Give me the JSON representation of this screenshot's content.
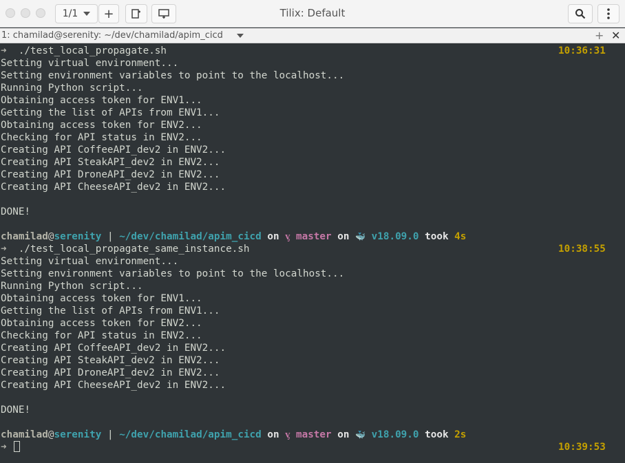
{
  "window": {
    "title": "Tilix: Default",
    "session_counter": "1/1"
  },
  "tab": {
    "title": "1: chamilad@serenity: ~/dev/chamilad/apim_cicd",
    "add": "+",
    "close": "✕"
  },
  "prompt_arrow": "➜",
  "blocks": [
    {
      "command": "./test_local_propagate.sh",
      "time": "10:36:31",
      "output": [
        "Setting virtual environment...",
        "Setting environment variables to point to the localhost...",
        "Running Python script...",
        "Obtaining access token for ENV1...",
        "Getting the list of APIs from ENV1...",
        "Obtaining access token for ENV2...",
        "Checking for API status in ENV2...",
        "Creating API CoffeeAPI_dev2 in ENV2...",
        "Creating API SteakAPI_dev2 in ENV2...",
        "Creating API DroneAPI_dev2 in ENV2...",
        "Creating API CheeseAPI_dev2 in ENV2...",
        "",
        "DONE!"
      ],
      "status": {
        "user": "chamilad",
        "at": "@",
        "host": "serenity",
        "sep": "|",
        "path": "~/dev/chamilad/apim_cicd",
        "on1": "on",
        "git_icon": "ᶌ",
        "branch": "master",
        "on2": "on",
        "docker_icon": "🐳",
        "version": "v18.09.0",
        "took": "took",
        "duration": "4s"
      }
    },
    {
      "command": "./test_local_propagate_same_instance.sh",
      "time": "10:38:55",
      "output": [
        "Setting virtual environment...",
        "Setting environment variables to point to the localhost...",
        "Running Python script...",
        "Obtaining access token for ENV1...",
        "Getting the list of APIs from ENV1...",
        "Obtaining access token for ENV2...",
        "Checking for API status in ENV2...",
        "Creating API CoffeeAPI_dev2 in ENV2...",
        "Creating API SteakAPI_dev2 in ENV2...",
        "Creating API DroneAPI_dev2 in ENV2...",
        "Creating API CheeseAPI_dev2 in ENV2...",
        "",
        "DONE!"
      ],
      "status": {
        "user": "chamilad",
        "at": "@",
        "host": "serenity",
        "sep": "|",
        "path": "~/dev/chamilad/apim_cicd",
        "on1": "on",
        "git_icon": "ᶌ",
        "branch": "master",
        "on2": "on",
        "docker_icon": "🐳",
        "version": "v18.09.0",
        "took": "took",
        "duration": "2s"
      }
    }
  ],
  "final_prompt_time": "10:39:53"
}
